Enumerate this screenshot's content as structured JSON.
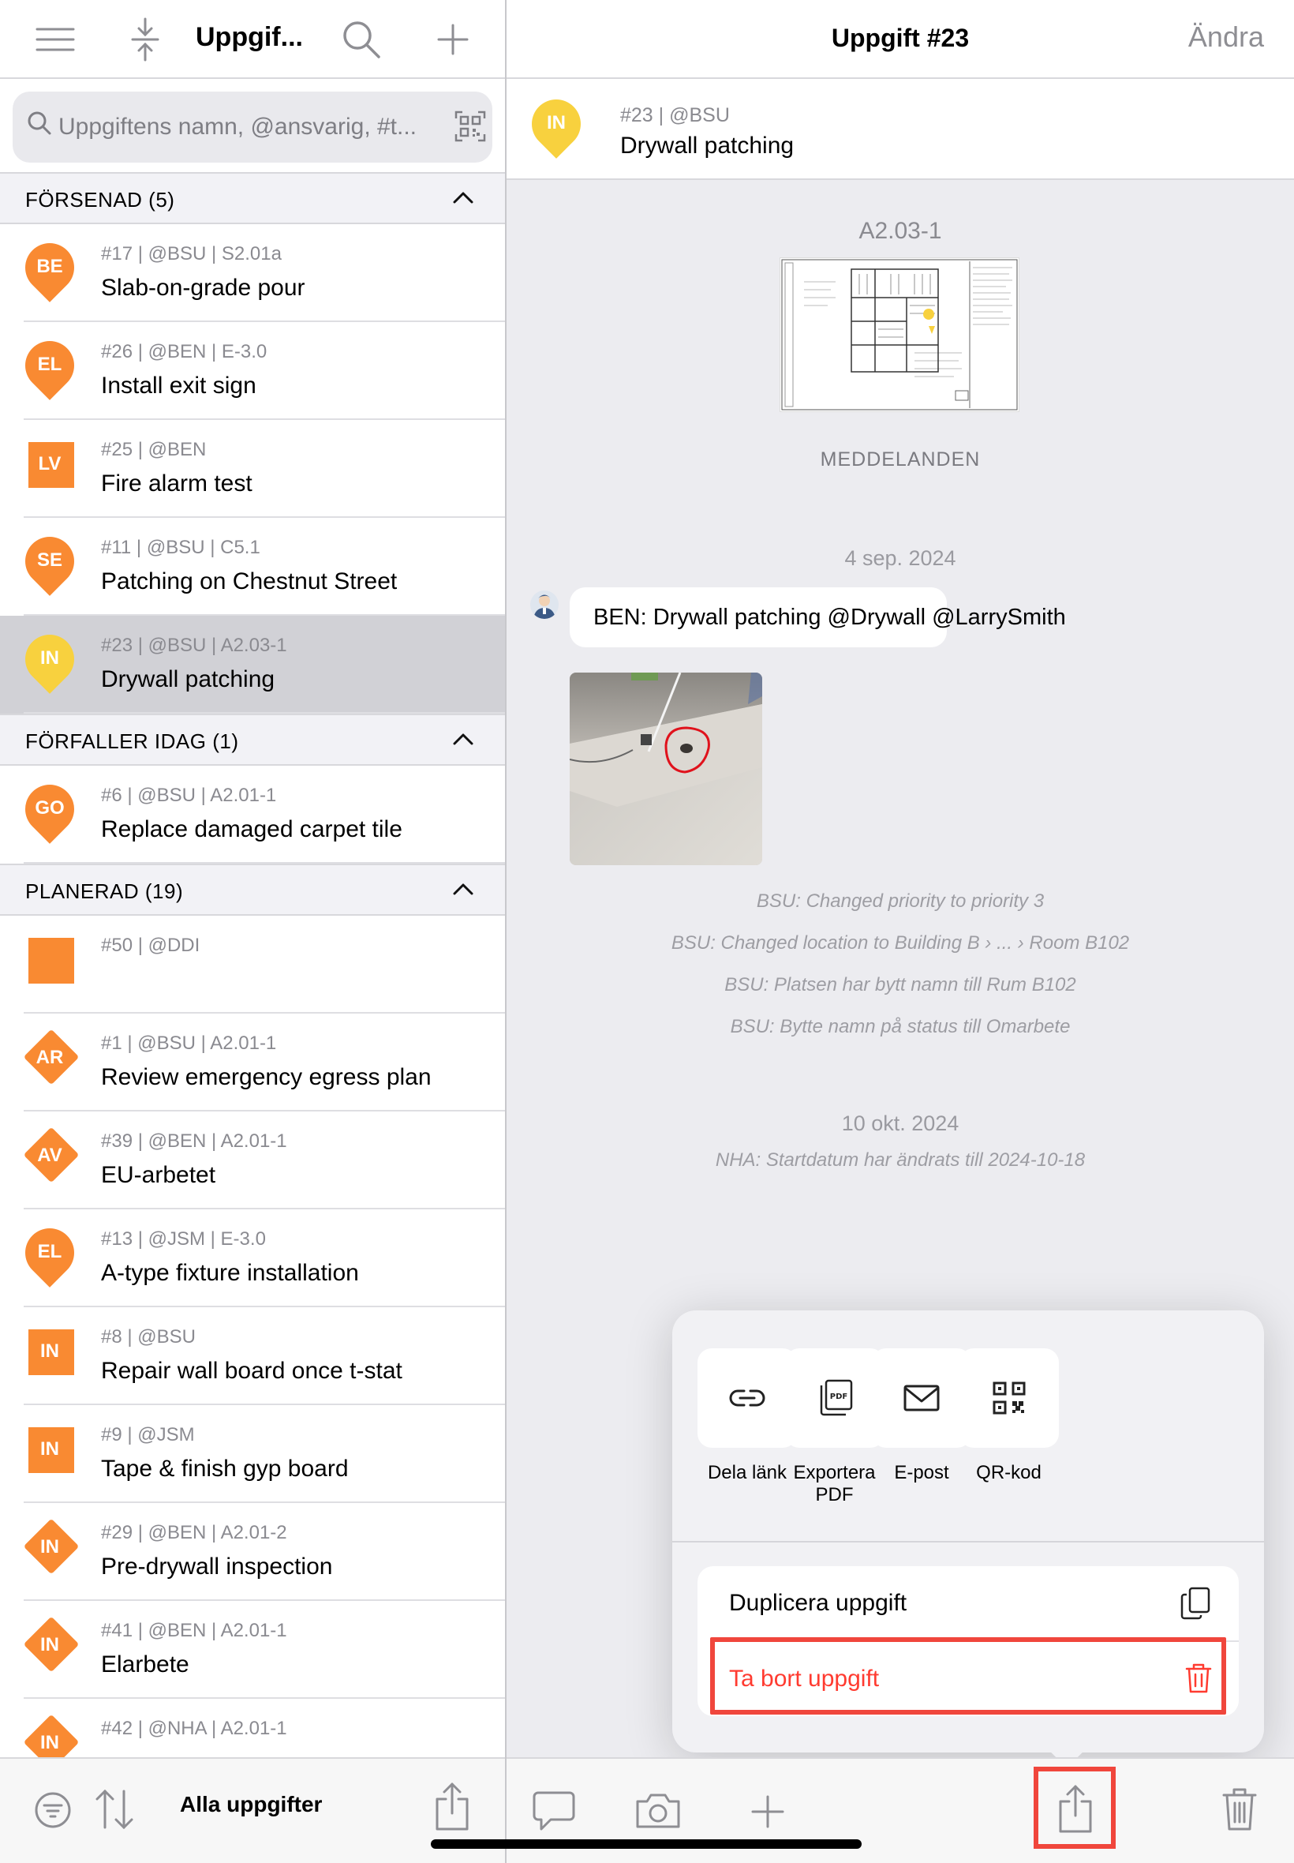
{
  "left_panel": {
    "title": "Uppgif...",
    "search_placeholder": "Uppgiftens namn, @ansvarig, #t...",
    "sections": [
      {
        "title": "FÖRSENAD (5)"
      },
      {
        "title": "FÖRFALLER IDAG (1)"
      },
      {
        "title": "PLANERAD (19)"
      }
    ],
    "tasks": [
      {
        "meta": "#17 | @BSU | S2.01a",
        "name": "Slab-on-grade pour",
        "code": "BE",
        "shape": "pin",
        "color": "#f98a32"
      },
      {
        "meta": "#26 | @BEN | E-3.0",
        "name": "Install exit sign",
        "code": "EL",
        "shape": "pin",
        "color": "#f98a32"
      },
      {
        "meta": "#25 | @BEN",
        "name": "Fire alarm test",
        "code": "LV",
        "shape": "square",
        "color": "#f98a32"
      },
      {
        "meta": "#11 | @BSU | C5.1",
        "name": "Patching on Chestnut Street",
        "code": "SE",
        "shape": "pin",
        "color": "#f98a32"
      },
      {
        "meta": "#23 | @BSU | A2.03-1",
        "name": "Drywall patching",
        "code": "IN",
        "shape": "pin",
        "color": "#f8d13e"
      },
      {
        "meta": "#6 | @BSU | A2.01-1",
        "name": "Replace damaged carpet tile",
        "code": "GO",
        "shape": "pin",
        "color": "#f98a32"
      },
      {
        "meta": "#50 | @DDI",
        "name": "",
        "code": "",
        "shape": "square",
        "color": "#f98a32"
      },
      {
        "meta": "#1 | @BSU | A2.01-1",
        "name": "Review emergency egress plan",
        "code": "AR",
        "shape": "diamond",
        "color": "#f98a32"
      },
      {
        "meta": "#39 | @BEN | A2.01-1",
        "name": "EU-arbetet",
        "code": "AV",
        "shape": "diamond",
        "color": "#f98a32"
      },
      {
        "meta": "#13 | @JSM | E-3.0",
        "name": "A-type fixture installation",
        "code": "EL",
        "shape": "pin",
        "color": "#f98a32"
      },
      {
        "meta": "#8 | @BSU",
        "name": "Repair wall board once t-stat",
        "code": "IN",
        "shape": "square",
        "color": "#f98a32"
      },
      {
        "meta": "#9 | @JSM",
        "name": "Tape & finish gyp board",
        "code": "IN",
        "shape": "square",
        "color": "#f98a32"
      },
      {
        "meta": "#29 | @BEN | A2.01-2",
        "name": "Pre-drywall inspection",
        "code": "IN",
        "shape": "diamond",
        "color": "#f98a32"
      },
      {
        "meta": "#41 | @BEN | A2.01-1",
        "name": "Elarbete",
        "code": "IN",
        "shape": "diamond",
        "color": "#f98a32"
      },
      {
        "meta": "#42 | @NHA | A2.01-1",
        "name": "",
        "code": "IN",
        "shape": "diamond",
        "color": "#f98a32"
      }
    ],
    "bottom_label": "Alla uppgifter"
  },
  "right_panel": {
    "title": "Uppgift #23",
    "edit_label": "Ändra",
    "task_meta": "#23 | @BSU",
    "task_name": "Drywall patching",
    "task_code": "IN",
    "task_color": "#f8d13e",
    "sheet_label": "A2.03-1",
    "messages_heading": "MEDDELANDEN",
    "date1": "4 sep. 2024",
    "message_text": "BEN: Drywall patching @Drywall @LarrySmith",
    "log_lines": [
      "BSU: Changed priority to priority 3",
      "BSU: Changed location to Building B › ... › Room B102",
      "BSU: Platsen har bytt namn till Rum B102",
      "BSU: Bytte namn på status till Omarbete"
    ],
    "date2": "10 okt. 2024",
    "log_line_2": "NHA: Startdatum har ändrats till 2024-10-18"
  },
  "share_menu": {
    "items": [
      {
        "label": "Dela länk",
        "icon": "link-icon"
      },
      {
        "label": "Exportera PDF",
        "icon": "pdf-icon"
      },
      {
        "label": "E-post",
        "icon": "mail-icon"
      },
      {
        "label": "QR-kod",
        "icon": "qr-code-icon"
      }
    ],
    "duplicate_label": "Duplicera uppgift",
    "delete_label": "Ta bort uppgift"
  },
  "colors": {
    "orange_marker": "#f98a32",
    "yellow_marker": "#f8d13e",
    "delete_red": "#ff3b30",
    "highlight_red": "#f0463c"
  }
}
